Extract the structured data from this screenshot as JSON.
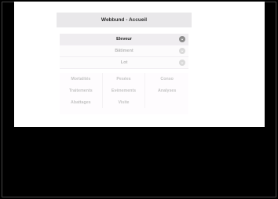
{
  "window": {
    "title": "Webbund - Accueil"
  },
  "menu": {
    "items": [
      {
        "label": "Eleveur",
        "state": "active",
        "icon": "chevron-down-icon"
      },
      {
        "label": "Bâtiment",
        "state": "inactive",
        "icon": "chevron-down-icon"
      },
      {
        "label": "Lot",
        "state": "inactive",
        "icon": "chevron-down-icon"
      }
    ]
  },
  "grid": {
    "rows": [
      [
        "Mortalités",
        "Pesées",
        "Conso"
      ],
      [
        "Traitements",
        "Evènements",
        "Analyses"
      ],
      [
        "Abattages",
        "Visite",
        ""
      ]
    ]
  },
  "colors": {
    "background": "#000000",
    "content": "#ffffff",
    "titlebar": "#e9e8ea",
    "active_text": "#1d1d1d",
    "inactive_text": "#b8b8b8"
  }
}
